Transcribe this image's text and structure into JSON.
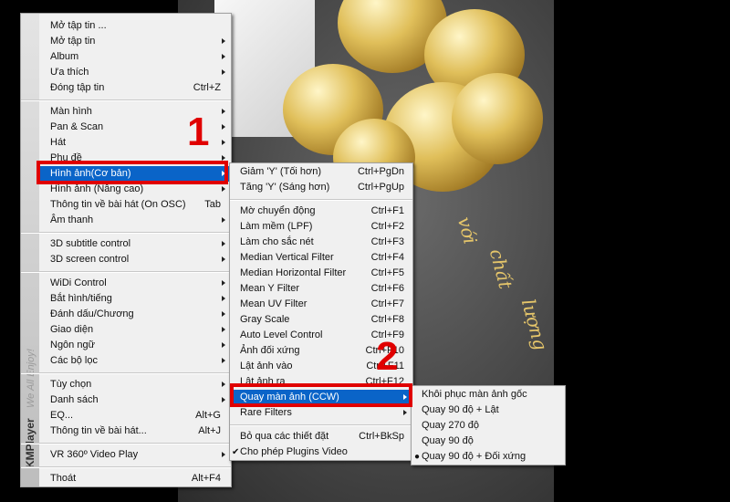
{
  "app": {
    "brand_name": "KMPlayer",
    "brand_tagline": "We All Enjoy!"
  },
  "main_menu": [
    {
      "label": "Mở tập tin ..."
    },
    {
      "label": "Mở tập tin",
      "submenu": true
    },
    {
      "label": "Album",
      "submenu": true
    },
    {
      "label": "Ưa thích",
      "submenu": true
    },
    {
      "label": "Đóng tập tin",
      "shortcut": "Ctrl+Z"
    },
    {
      "sep": true
    },
    {
      "label": "Màn hình",
      "submenu": true
    },
    {
      "label": "Pan & Scan",
      "submenu": true
    },
    {
      "label": "Hát",
      "submenu": true
    },
    {
      "label": "Phụ đề",
      "submenu": true
    },
    {
      "label": "Hình ảnh(Cơ bản)",
      "submenu": true,
      "highlighted": true
    },
    {
      "label": "Hình ảnh (Nâng cao)",
      "submenu": true
    },
    {
      "label": "Thông tin về bài hát (On OSC)",
      "shortcut": "Tab"
    },
    {
      "label": "Âm thanh",
      "submenu": true
    },
    {
      "sep": true
    },
    {
      "label": "3D subtitle control",
      "submenu": true
    },
    {
      "label": "3D screen control",
      "submenu": true
    },
    {
      "sep": true
    },
    {
      "label": "WiDi Control",
      "submenu": true
    },
    {
      "label": "Bắt hình/tiếng",
      "submenu": true
    },
    {
      "label": "Đánh dấu/Chương",
      "submenu": true
    },
    {
      "label": "Giao diện",
      "submenu": true
    },
    {
      "label": "Ngôn ngữ",
      "submenu": true
    },
    {
      "label": "Các bộ lọc",
      "submenu": true
    },
    {
      "sep": true
    },
    {
      "label": "Tùy chọn",
      "submenu": true
    },
    {
      "label": "Danh sách",
      "submenu": true
    },
    {
      "label": "EQ...",
      "shortcut": "Alt+G"
    },
    {
      "label": "Thông tin về bài hát...",
      "shortcut": "Alt+J"
    },
    {
      "sep": true
    },
    {
      "label": "VR 360º Video Play",
      "submenu": true
    },
    {
      "sep": true
    },
    {
      "label": "Thoát",
      "shortcut": "Alt+F4"
    }
  ],
  "image_menu": [
    {
      "label": "Giảm 'Y' (Tối hơn)",
      "shortcut": "Ctrl+PgDn"
    },
    {
      "label": "Tăng 'Y' (Sáng hơn)",
      "shortcut": "Ctrl+PgUp"
    },
    {
      "sep": true
    },
    {
      "label": "Mờ chuyển động",
      "shortcut": "Ctrl+F1"
    },
    {
      "label": "Làm mềm (LPF)",
      "shortcut": "Ctrl+F2"
    },
    {
      "label": "Làm cho sắc nét",
      "shortcut": "Ctrl+F3"
    },
    {
      "label": "Median Vertical Filter",
      "shortcut": "Ctrl+F4"
    },
    {
      "label": "Median Horizontal Filter",
      "shortcut": "Ctrl+F5"
    },
    {
      "label": "Mean Y Filter",
      "shortcut": "Ctrl+F6"
    },
    {
      "label": "Mean UV Filter",
      "shortcut": "Ctrl+F7"
    },
    {
      "label": "Gray Scale",
      "shortcut": "Ctrl+F8"
    },
    {
      "label": "Auto Level Control",
      "shortcut": "Ctrl+F9"
    },
    {
      "label": "Ảnh đối xứng",
      "shortcut": "Ctrl+F10"
    },
    {
      "label": "Lật ảnh vào",
      "shortcut": "Ctrl+F11"
    },
    {
      "label": "Lật ảnh ra",
      "shortcut": "Ctrl+F12"
    },
    {
      "label": "Quay màn ảnh (CCW)",
      "submenu": true,
      "highlighted": true
    },
    {
      "label": "Rare Filters",
      "submenu": true
    },
    {
      "sep": true
    },
    {
      "label": "Bỏ qua các thiết đặt",
      "shortcut": "Ctrl+BkSp"
    },
    {
      "label": "Cho phép Plugins Video",
      "checked": true
    }
  ],
  "rotate_menu": [
    {
      "label": "Khôi phục màn ảnh gốc"
    },
    {
      "label": "Quay 90 độ + Lật"
    },
    {
      "label": "Quay 270 độ"
    },
    {
      "label": "Quay 90 độ"
    },
    {
      "label": "Quay 90 độ + Đối xứng",
      "selected": true
    }
  ],
  "annotations": {
    "step1": "1",
    "step2": "2",
    "color": "#e00000"
  },
  "video_text": [
    "với",
    "chất",
    "lượng"
  ],
  "colors": {
    "highlight": "#0a64c8",
    "menu_bg": "#f0f0f0"
  }
}
